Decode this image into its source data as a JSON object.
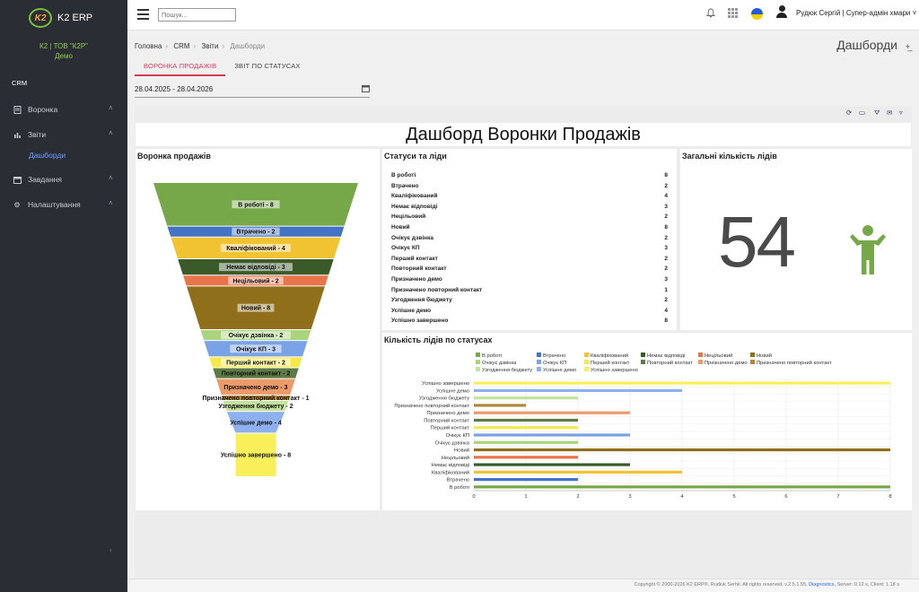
{
  "sidebar": {
    "logo_mark": "K2",
    "logo_text": "K2 ERP",
    "company_line1": "К2 | ТОВ \"К2Р\"",
    "company_line2": "Демо",
    "section": "CRM",
    "items": [
      {
        "label": "Воронка",
        "icon": "funnel-icon"
      },
      {
        "label": "Звіти",
        "icon": "chart-icon"
      },
      {
        "label": "Завдання",
        "icon": "calendar-icon"
      },
      {
        "label": "Налаштування",
        "icon": "gear-icon"
      }
    ],
    "sub_item": "Дашборди"
  },
  "topbar": {
    "search_placeholder": "Пошук...",
    "user": "Рудюк Сергій | Супер-адмін хмари"
  },
  "breadcrumb": {
    "items": [
      "Головна",
      "CRM",
      "Звіти"
    ],
    "current": "Дашборди"
  },
  "page_title": "Дашборди",
  "tabs": [
    {
      "label": "ВОРОНКА ПРОДАЖІВ",
      "active": true
    },
    {
      "label": "ЗВІТ ПО СТАТУСАХ",
      "active": false
    }
  ],
  "date_range": "28.04.2025 - 28.04.2026",
  "dashboard_title": "Дашборд Воронки Продажів",
  "funnel_panel": {
    "title": "Воронка продажів"
  },
  "status_panel": {
    "title": "Статуси та ліди",
    "rows": [
      {
        "name": "В роботі",
        "count": "8"
      },
      {
        "name": "Втрачено",
        "count": "2"
      },
      {
        "name": "Кваліфікований",
        "count": "4"
      },
      {
        "name": "Немає відповіді",
        "count": "3"
      },
      {
        "name": "Нецільовий",
        "count": "2"
      },
      {
        "name": "Новий",
        "count": "8"
      },
      {
        "name": "Очікує дзвінка",
        "count": "2"
      },
      {
        "name": "Очікує КП",
        "count": "3"
      },
      {
        "name": "Перший контакт",
        "count": "2"
      },
      {
        "name": "Повторний контакт",
        "count": "2"
      },
      {
        "name": "Призначено демо",
        "count": "3"
      },
      {
        "name": "Призначено повторний контакт",
        "count": "1"
      },
      {
        "name": "Узгодження бюджету",
        "count": "2"
      },
      {
        "name": "Успішне демо",
        "count": "4"
      },
      {
        "name": "Успішно завершено",
        "count": "8"
      }
    ]
  },
  "total_panel": {
    "title": "Загальні кількість лідів",
    "value": "54"
  },
  "bar_panel": {
    "title": "Кількість лідів по статусах"
  },
  "chart_data": [
    {
      "type": "funnel",
      "title": "Воронка продажів",
      "stages": [
        {
          "label": "В роботі - 8",
          "value": 8,
          "color": "#76a84a"
        },
        {
          "label": "Втрачено - 2",
          "value": 2,
          "color": "#4472c4"
        },
        {
          "label": "Кваліфікований - 4",
          "value": 4,
          "color": "#f1c232"
        },
        {
          "label": "Немає відповіді - 3",
          "value": 3,
          "color": "#3b5a2a"
        },
        {
          "label": "Нецільовий - 2",
          "value": 2,
          "color": "#e8744a"
        },
        {
          "label": "Новий - 8",
          "value": 8,
          "color": "#8f6f1a"
        },
        {
          "label": "Очікує дзвінка - 2",
          "value": 2,
          "color": "#a9d37c"
        },
        {
          "label": "Очікує КП - 3",
          "value": 3,
          "color": "#7aa2e6"
        },
        {
          "label": "Перший контакт - 2",
          "value": 2,
          "color": "#f5e94a"
        },
        {
          "label": "Повторний контакт - 2",
          "value": 2,
          "color": "#5e7a45"
        },
        {
          "label": "Призначено демо - 3",
          "value": 3,
          "color": "#eb9b6a"
        },
        {
          "label": "Призначено повторний контакт - 1",
          "value": 1,
          "color": "#b0883a"
        },
        {
          "label": "Узгодження бюджету - 2",
          "value": 2,
          "color": "#c3e29b"
        },
        {
          "label": "Успішне демо - 4",
          "value": 4,
          "color": "#8fb0ef"
        },
        {
          "label": "Успішно завершено - 8",
          "value": 8,
          "color": "#f8ef5a"
        }
      ]
    },
    {
      "type": "bar",
      "orientation": "horizontal",
      "title": "Кількість лідів по статусах",
      "categories": [
        "В роботі",
        "Втрачено",
        "Кваліфікований",
        "Немає відповіді",
        "Нецільовий",
        "Новий",
        "Очікує дзвінка",
        "Очікує КП",
        "Перший контакт",
        "Повторний контакт",
        "Призначено демо",
        "Призначено повторний контакт",
        "Узгодження бюджету",
        "Успішне демо",
        "Успішно завершено"
      ],
      "values": [
        8,
        2,
        4,
        3,
        2,
        8,
        2,
        3,
        2,
        2,
        3,
        1,
        2,
        4,
        8
      ],
      "colors": [
        "#76a84a",
        "#4472c4",
        "#f1c232",
        "#3b5a2a",
        "#e8744a",
        "#8f6f1a",
        "#a9d37c",
        "#7aa2e6",
        "#f5e94a",
        "#5e7a45",
        "#eb9b6a",
        "#b0883a",
        "#c3e29b",
        "#8fb0ef",
        "#f8ef5a"
      ],
      "xlim": [
        0,
        8
      ],
      "xticks": [
        "0",
        "1",
        "2",
        "3",
        "4",
        "5",
        "6",
        "7",
        "8"
      ],
      "legend_position": "top",
      "grid": true
    }
  ],
  "footer": {
    "text_before": "Copyright © 2000-2026 K2 ERP®, Rudiuk Serhii. All rights reserved. v.2.5.1.55,",
    "link": "Diagnostics",
    "text_after": ", Server: 0.12 s, Client: 1.18 s"
  }
}
